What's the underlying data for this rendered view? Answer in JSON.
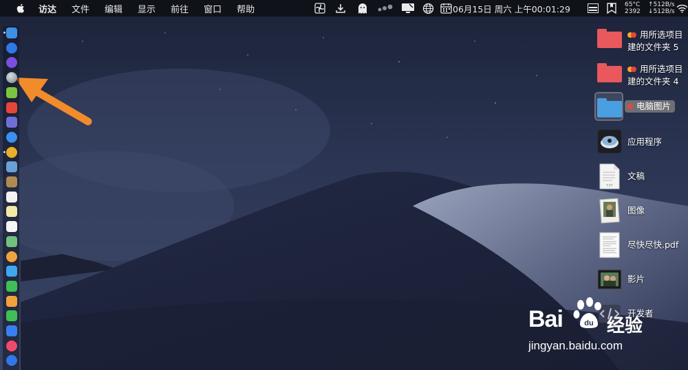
{
  "menubar": {
    "app_name": "访达",
    "menus": [
      "文件",
      "编辑",
      "显示",
      "前往",
      "窗口",
      "帮助"
    ],
    "clock": "06月15日 周六 上午00:01:29",
    "sensors": {
      "temperature": "65°C",
      "fan_rpm": "2392"
    },
    "network": {
      "up": "↑512B/s",
      "down": "↓512B/s"
    }
  },
  "dock": {
    "icons": [
      {
        "name": "finder-icon",
        "color": "#3f8fe3"
      },
      {
        "name": "app-store-icon",
        "color": "#2f78e6"
      },
      {
        "name": "siri-icon",
        "color": "#7a4fe0"
      },
      {
        "name": "launchpad-icon",
        "color": "#9aa2ad"
      },
      {
        "name": "android-icon",
        "color": "#7cc540"
      },
      {
        "name": "calendar-app-icon",
        "color": "#e6453a"
      },
      {
        "name": "calculator-icon",
        "color": "#6d6fd8"
      },
      {
        "name": "safari-icon",
        "color": "#3a8ff0"
      },
      {
        "name": "chrome-icon",
        "color": "#e9b028"
      },
      {
        "name": "preview-icon",
        "color": "#6aa0d8"
      },
      {
        "name": "contacts-icon",
        "color": "#b08a55"
      },
      {
        "name": "calendar-icon",
        "color": "#f2f2f2"
      },
      {
        "name": "notes-icon",
        "color": "#f3e9a6"
      },
      {
        "name": "reminders-icon",
        "color": "#f5f5f5"
      },
      {
        "name": "maps-icon",
        "color": "#71c07b"
      },
      {
        "name": "photos-icon",
        "color": "#f0a33a"
      },
      {
        "name": "messages-icon",
        "color": "#3fa7f0"
      },
      {
        "name": "facetime-icon",
        "color": "#3fbf55"
      },
      {
        "name": "pages-icon",
        "color": "#f0a33a"
      },
      {
        "name": "numbers-icon",
        "color": "#3fbf55"
      },
      {
        "name": "keynote-icon",
        "color": "#3a7ff0"
      },
      {
        "name": "music-icon",
        "color": "#f04a6b"
      },
      {
        "name": "app-store-bottom-icon",
        "color": "#2f78e6"
      }
    ]
  },
  "desktop_items": [
    {
      "name": "desktop-folder-5",
      "line1": "用所选项目",
      "line2": "建的文件夹 5",
      "kind": "folder-red"
    },
    {
      "name": "desktop-folder-4",
      "line1": "用所选项目",
      "line2": "建的文件夹 4",
      "kind": "folder-red"
    },
    {
      "name": "desktop-folder-photos",
      "label": "电脑图片",
      "kind": "folder-blue-selected"
    },
    {
      "name": "desktop-applications",
      "label": "应用程序",
      "kind": "app"
    },
    {
      "name": "desktop-documents",
      "label": "文稿",
      "kind": "doc"
    },
    {
      "name": "desktop-images",
      "label": "图像",
      "kind": "image"
    },
    {
      "name": "desktop-pdf",
      "label": "尽快尽快.pdf",
      "kind": "pdf"
    },
    {
      "name": "desktop-movies",
      "label": "影片",
      "kind": "movie"
    },
    {
      "name": "desktop-developer",
      "label": "开发者",
      "kind": "dev"
    }
  ],
  "colors": {
    "menubar_bg": "#101219",
    "folder_red": "#e8585c",
    "folder_blue": "#4a9fe0",
    "tag_orange": "#f5a623",
    "tag_red": "#e8453c",
    "arrow": "#f28b2c"
  },
  "watermark": {
    "brand": "Bai",
    "brand_cn": "经验",
    "url": "jingyan.baidu.com"
  }
}
